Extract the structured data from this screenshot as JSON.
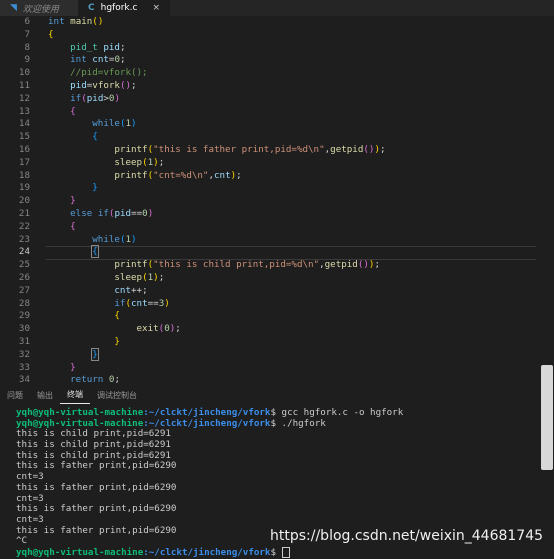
{
  "tabs": [
    {
      "label": "欢迎使用",
      "icon": "vscode-icon",
      "active": false
    },
    {
      "label": "hgfork.c",
      "icon": "c-file-icon",
      "active": true,
      "close": "×"
    }
  ],
  "editor": {
    "current_line": 24,
    "lines": [
      {
        "n": "6",
        "tokens": [
          [
            "kw",
            "int"
          ],
          [
            "op",
            " "
          ],
          [
            "fn",
            "main"
          ],
          [
            "p1",
            "()"
          ]
        ]
      },
      {
        "n": "7",
        "tokens": [
          [
            "p1",
            "{"
          ]
        ]
      },
      {
        "n": "8",
        "tokens": [
          [
            "op",
            "    "
          ],
          [
            "type",
            "pid_t"
          ],
          [
            "op",
            " "
          ],
          [
            "var",
            "pid"
          ],
          [
            "op",
            ";"
          ]
        ]
      },
      {
        "n": "9",
        "tokens": [
          [
            "op",
            "    "
          ],
          [
            "kw",
            "int"
          ],
          [
            "op",
            " "
          ],
          [
            "var",
            "cnt"
          ],
          [
            "op",
            "="
          ],
          [
            "num",
            "0"
          ],
          [
            "op",
            ";"
          ]
        ]
      },
      {
        "n": "10",
        "tokens": [
          [
            "op",
            "    "
          ],
          [
            "cm",
            "//pid=vfork();"
          ]
        ]
      },
      {
        "n": "11",
        "tokens": [
          [
            "op",
            "    "
          ],
          [
            "var",
            "pid"
          ],
          [
            "op",
            "="
          ],
          [
            "fn",
            "vfork"
          ],
          [
            "p2",
            "()"
          ],
          [
            "op",
            ";"
          ]
        ]
      },
      {
        "n": "12",
        "tokens": [
          [
            "op",
            "    "
          ],
          [
            "kw",
            "if"
          ],
          [
            "p2",
            "("
          ],
          [
            "var",
            "pid"
          ],
          [
            "op",
            ">"
          ],
          [
            "num",
            "0"
          ],
          [
            "p2",
            ")"
          ]
        ]
      },
      {
        "n": "13",
        "tokens": [
          [
            "op",
            "    "
          ],
          [
            "p2",
            "{"
          ]
        ]
      },
      {
        "n": "14",
        "tokens": [
          [
            "op",
            "        "
          ],
          [
            "kw",
            "while"
          ],
          [
            "p3",
            "("
          ],
          [
            "num",
            "1"
          ],
          [
            "p3",
            ")"
          ]
        ]
      },
      {
        "n": "15",
        "tokens": [
          [
            "op",
            "        "
          ],
          [
            "p3",
            "{"
          ]
        ]
      },
      {
        "n": "16",
        "tokens": [
          [
            "op",
            "            "
          ],
          [
            "fn",
            "printf"
          ],
          [
            "p1",
            "("
          ],
          [
            "str",
            "\"this is father print,pid=%d\\n\""
          ],
          [
            "op",
            ","
          ],
          [
            "fn",
            "getpid"
          ],
          [
            "p2",
            "()"
          ],
          [
            "p1",
            ")"
          ],
          [
            "op",
            ";"
          ]
        ]
      },
      {
        "n": "17",
        "tokens": [
          [
            "op",
            "            "
          ],
          [
            "fn",
            "sleep"
          ],
          [
            "p1",
            "("
          ],
          [
            "num",
            "1"
          ],
          [
            "p1",
            ")"
          ],
          [
            "op",
            ";"
          ]
        ]
      },
      {
        "n": "18",
        "tokens": [
          [
            "op",
            "            "
          ],
          [
            "fn",
            "printf"
          ],
          [
            "p1",
            "("
          ],
          [
            "str",
            "\"cnt=%d\\n\""
          ],
          [
            "op",
            ","
          ],
          [
            "var",
            "cnt"
          ],
          [
            "p1",
            ")"
          ],
          [
            "op",
            ";"
          ]
        ]
      },
      {
        "n": "19",
        "tokens": [
          [
            "op",
            "        "
          ],
          [
            "p3",
            "}"
          ]
        ]
      },
      {
        "n": "20",
        "tokens": [
          [
            "op",
            "    "
          ],
          [
            "p2",
            "}"
          ]
        ]
      },
      {
        "n": "21",
        "tokens": [
          [
            "op",
            "    "
          ],
          [
            "kw",
            "else"
          ],
          [
            "op",
            " "
          ],
          [
            "kw",
            "if"
          ],
          [
            "p2",
            "("
          ],
          [
            "var",
            "pid"
          ],
          [
            "op",
            "=="
          ],
          [
            "num",
            "0"
          ],
          [
            "p2",
            ")"
          ]
        ]
      },
      {
        "n": "22",
        "tokens": [
          [
            "op",
            "    "
          ],
          [
            "p2",
            "{"
          ]
        ]
      },
      {
        "n": "23",
        "tokens": [
          [
            "op",
            "        "
          ],
          [
            "kw",
            "while"
          ],
          [
            "p3",
            "("
          ],
          [
            "num",
            "1"
          ],
          [
            "p3",
            ")"
          ]
        ]
      },
      {
        "n": "24",
        "tokens": [
          [
            "op",
            "        "
          ],
          [
            "p3box",
            "{"
          ]
        ]
      },
      {
        "n": "25",
        "tokens": [
          [
            "op",
            "            "
          ],
          [
            "fn",
            "printf"
          ],
          [
            "p1",
            "("
          ],
          [
            "str",
            "\"this is child print,pid=%d\\n\""
          ],
          [
            "op",
            ","
          ],
          [
            "fn",
            "getpid"
          ],
          [
            "p2",
            "()"
          ],
          [
            "p1",
            ")"
          ],
          [
            "op",
            ";"
          ]
        ]
      },
      {
        "n": "26",
        "tokens": [
          [
            "op",
            "            "
          ],
          [
            "fn",
            "sleep"
          ],
          [
            "p1",
            "("
          ],
          [
            "num",
            "1"
          ],
          [
            "p1",
            ")"
          ],
          [
            "op",
            ";"
          ]
        ]
      },
      {
        "n": "27",
        "tokens": [
          [
            "op",
            "            "
          ],
          [
            "var",
            "cnt"
          ],
          [
            "op",
            "++;"
          ]
        ]
      },
      {
        "n": "28",
        "tokens": [
          [
            "op",
            "            "
          ],
          [
            "kw",
            "if"
          ],
          [
            "p1",
            "("
          ],
          [
            "var",
            "cnt"
          ],
          [
            "op",
            "=="
          ],
          [
            "num",
            "3"
          ],
          [
            "p1",
            ")"
          ]
        ]
      },
      {
        "n": "29",
        "tokens": [
          [
            "op",
            "            "
          ],
          [
            "p1",
            "{"
          ]
        ]
      },
      {
        "n": "30",
        "tokens": [
          [
            "op",
            "                "
          ],
          [
            "fn",
            "exit"
          ],
          [
            "p2",
            "("
          ],
          [
            "num",
            "0"
          ],
          [
            "p2",
            ")"
          ],
          [
            "op",
            ";"
          ]
        ]
      },
      {
        "n": "31",
        "tokens": [
          [
            "op",
            "            "
          ],
          [
            "p1",
            "}"
          ]
        ]
      },
      {
        "n": "32",
        "tokens": [
          [
            "op",
            "        "
          ],
          [
            "p3box",
            "}"
          ]
        ]
      },
      {
        "n": "33",
        "tokens": [
          [
            "op",
            "    "
          ],
          [
            "p2",
            "}"
          ]
        ]
      },
      {
        "n": "34",
        "tokens": [
          [
            "op",
            "    "
          ],
          [
            "kw",
            "return"
          ],
          [
            "op",
            " "
          ],
          [
            "num",
            "0"
          ],
          [
            "op",
            ";"
          ]
        ]
      }
    ]
  },
  "panel": {
    "tabs": [
      "问题",
      "输出",
      "终端",
      "调试控制台"
    ],
    "active_tab": "终端"
  },
  "terminal": {
    "lines": [
      {
        "user": "yqh@yqh-virtual-machine",
        "path": ":~/clckt/jincheng/vfork",
        "cmd": "$ gcc hgfork.c -o hgfork"
      },
      {
        "user": "yqh@yqh-virtual-machine",
        "path": ":~/clckt/jincheng/vfork",
        "cmd": "$ ./hgfork"
      },
      {
        "text": "this is child print,pid=6291"
      },
      {
        "text": "this is child print,pid=6291"
      },
      {
        "text": "this is child print,pid=6291"
      },
      {
        "text": "this is father print,pid=6290"
      },
      {
        "text": "cnt=3"
      },
      {
        "text": "this is father print,pid=6290"
      },
      {
        "text": "cnt=3"
      },
      {
        "text": "this is father print,pid=6290"
      },
      {
        "text": "cnt=3"
      },
      {
        "text": "this is father print,pid=6290"
      },
      {
        "text": "^C"
      },
      {
        "user": "yqh@yqh-virtual-machine",
        "path": ":~/clckt/jincheng/vfork",
        "cmd": "$ ",
        "cursor": true
      }
    ]
  },
  "watermark": "https://blog.csdn.net/weixin_44681745",
  "colors": {
    "background": "#1e1e1e",
    "keyword": "#569cd6",
    "function": "#dcdcaa",
    "string": "#ce9178",
    "prompt_user": "#0dbc79",
    "prompt_path": "#3b8eea"
  }
}
